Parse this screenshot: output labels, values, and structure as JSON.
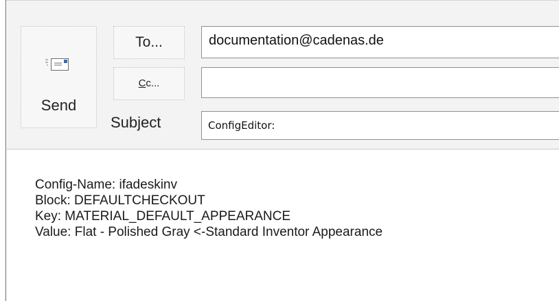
{
  "compose": {
    "send_label": "Send",
    "to_button_label": "To...",
    "cc_button_prefix": "C",
    "cc_button_rest": "c...",
    "subject_label": "Subject",
    "to_value": "documentation@cadenas.de",
    "cc_value": "",
    "subject_value": "ConfigEditor:"
  },
  "message": {
    "lines": [
      "Config-Name: ifadeskinv",
      "Block: DEFAULTCHECKOUT",
      "Key: MATERIAL_DEFAULT_APPEARANCE",
      "Value: Flat - Polished Gray <-Standard Inventor Appearance"
    ]
  },
  "icons": {
    "send": "envelope-send-icon"
  },
  "colors": {
    "header_bg": "#f3f3f3",
    "icon_accent": "#2b6fc4"
  }
}
